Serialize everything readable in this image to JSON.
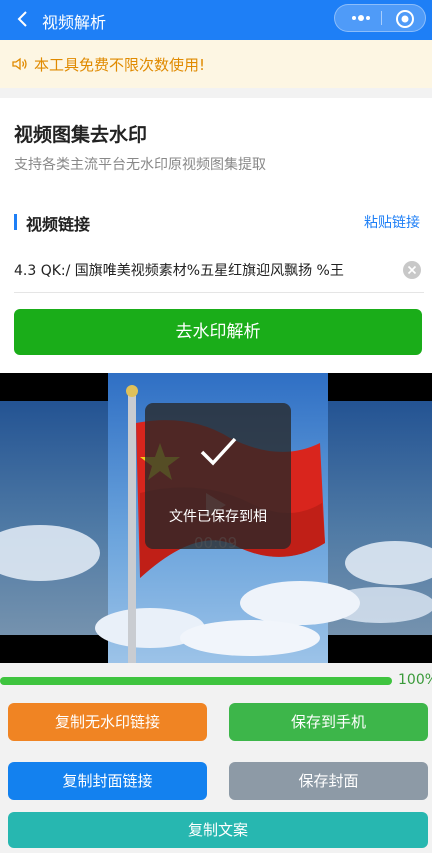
{
  "header": {
    "title": "视频解析"
  },
  "colors": {
    "brand": "#1e7ff6",
    "primary_green": "#1aad19",
    "notice_text": "#e08a00"
  },
  "notice": {
    "text": "本工具免费不限次数使用!"
  },
  "card": {
    "title": "视频图集去水印",
    "subtitle": "支持各类主流平台无水印原视频图集提取",
    "section_label": "视频链接",
    "paste_label": "粘贴链接",
    "url_value": "4.3 QK:/ 国旗唯美视频素材%五星红旗迎风飘扬 %王",
    "parse_label": "去水印解析"
  },
  "video": {
    "toast_text": "文件已保存到相",
    "time": "00:09"
  },
  "progress": {
    "percent_label": "100%",
    "value": 1.0
  },
  "actions": {
    "copy_link": "复制无水印链接",
    "save_phone": "保存到手机",
    "copy_cover": "复制封面链接",
    "save_cover": "保存封面",
    "copy_text": "复制文案"
  }
}
